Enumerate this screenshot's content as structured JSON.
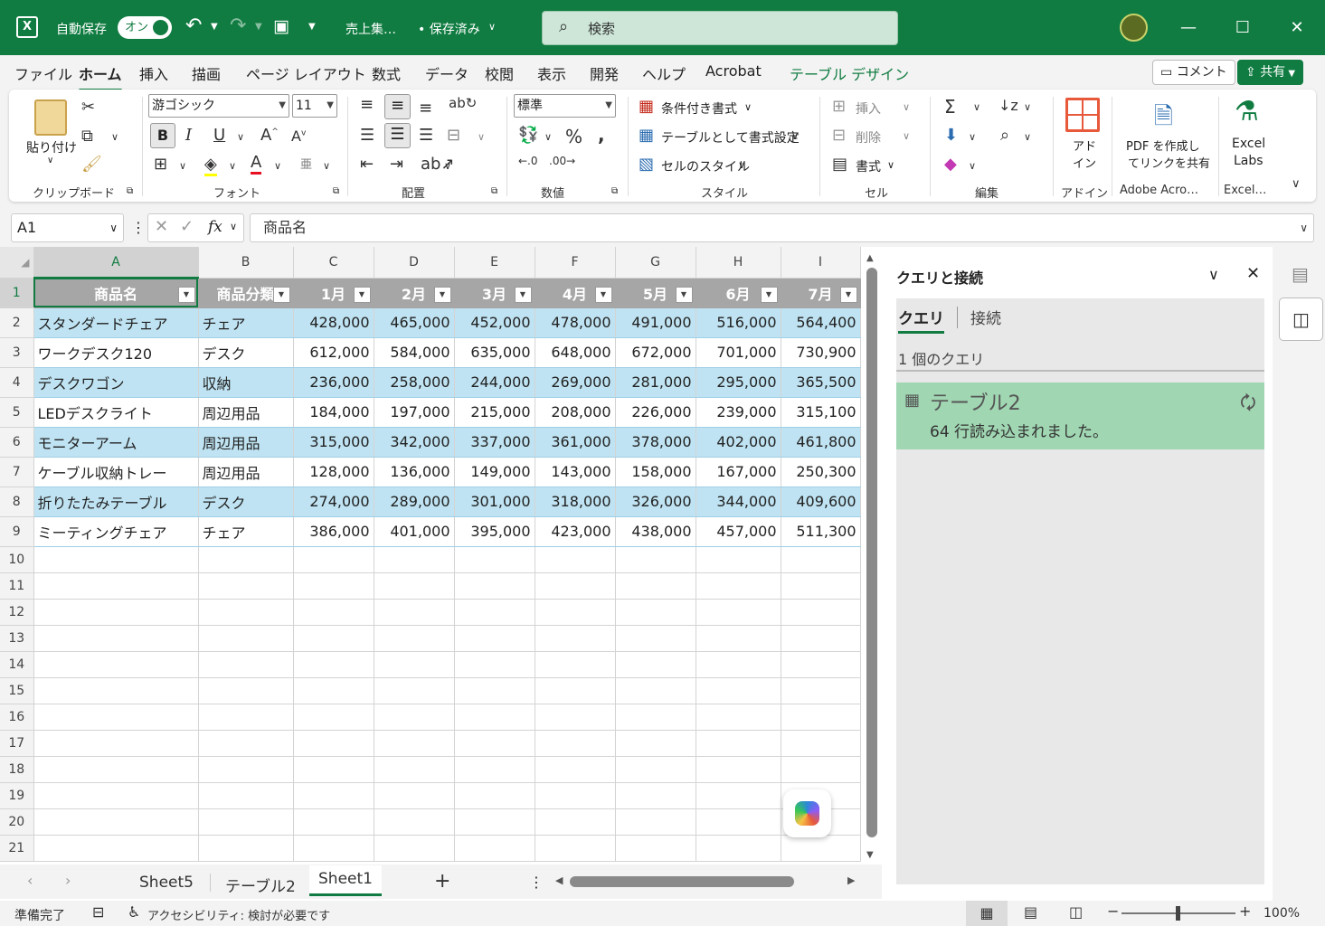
{
  "titlebar": {
    "autosave_label": "自動保存",
    "autosave_state": "オン",
    "filename": "売上集…",
    "save_status": "• 保存済み",
    "search_placeholder": "検索"
  },
  "tabs": [
    "ファイル",
    "ホーム",
    "挿入",
    "描画",
    "ページ レイアウト",
    "数式",
    "データ",
    "校閲",
    "表示",
    "開発",
    "ヘルプ",
    "Acrobat",
    "テーブル デザイン"
  ],
  "actions": {
    "comment": "コメント",
    "share": "共有"
  },
  "ribbon": {
    "clipboard": {
      "paste": "貼り付け",
      "label": "クリップボード"
    },
    "font": {
      "name": "游ゴシック",
      "size": "11",
      "label": "フォント"
    },
    "alignment": {
      "label": "配置"
    },
    "number": {
      "format": "標準",
      "label": "数値"
    },
    "styles": {
      "conditional": "条件付き書式",
      "as_table": "テーブルとして書式設定",
      "cell_styles": "セルのスタイル",
      "label": "スタイル"
    },
    "cells": {
      "insert": "挿入",
      "delete": "削除",
      "format": "書式",
      "label": "セル"
    },
    "editing": {
      "label": "編集"
    },
    "addins": {
      "line1": "アド",
      "line2": "イン",
      "label": "アドイン"
    },
    "adobe": {
      "line1": "PDF を作成し",
      "line2": "てリンクを共有",
      "label": "Adobe Acro…"
    },
    "labs": {
      "line1": "Excel",
      "line2": "Labs",
      "label": "Excel…"
    }
  },
  "formula_bar": {
    "name_box": "A1",
    "fx": "fx",
    "content": "商品名"
  },
  "columns": [
    "A",
    "B",
    "C",
    "D",
    "E",
    "F",
    "G",
    "H",
    "I"
  ],
  "table": {
    "headers": [
      "商品名",
      "商品分類",
      "1月",
      "2月",
      "3月",
      "4月",
      "5月",
      "6月",
      "7月"
    ],
    "rows": [
      [
        "スタンダードチェア",
        "チェア",
        "428,000",
        "465,000",
        "452,000",
        "478,000",
        "491,000",
        "516,000",
        "564,400"
      ],
      [
        "ワークデスク120",
        "デスク",
        "612,000",
        "584,000",
        "635,000",
        "648,000",
        "672,000",
        "701,000",
        "730,900"
      ],
      [
        "デスクワゴン",
        "収納",
        "236,000",
        "258,000",
        "244,000",
        "269,000",
        "281,000",
        "295,000",
        "365,500"
      ],
      [
        "LEDデスクライト",
        "周辺用品",
        "184,000",
        "197,000",
        "215,000",
        "208,000",
        "226,000",
        "239,000",
        "315,100"
      ],
      [
        "モニターアーム",
        "周辺用品",
        "315,000",
        "342,000",
        "337,000",
        "361,000",
        "378,000",
        "402,000",
        "461,800"
      ],
      [
        "ケーブル収納トレー",
        "周辺用品",
        "128,000",
        "136,000",
        "149,000",
        "143,000",
        "158,000",
        "167,000",
        "250,300"
      ],
      [
        "折りたたみテーブル",
        "デスク",
        "274,000",
        "289,000",
        "301,000",
        "318,000",
        "326,000",
        "344,000",
        "409,600"
      ],
      [
        "ミーティングチェア",
        "チェア",
        "386,000",
        "401,000",
        "395,000",
        "423,000",
        "438,000",
        "457,000",
        "511,300"
      ]
    ]
  },
  "row_numbers": [
    "1",
    "2",
    "3",
    "4",
    "5",
    "6",
    "7",
    "8",
    "9",
    "10",
    "11",
    "12",
    "13",
    "14",
    "15",
    "16",
    "17",
    "18",
    "19",
    "20",
    "21"
  ],
  "sheets": [
    "Sheet5",
    "テーブル2",
    "Sheet1"
  ],
  "active_sheet": "Sheet1",
  "status": {
    "ready": "準備完了",
    "accessibility": "アクセシビリティ: 検討が必要です",
    "zoom": "100%"
  },
  "pane": {
    "title": "クエリと接続",
    "tab_queries": "クエリ",
    "tab_connections": "接続",
    "count": "1 個のクエリ",
    "query_name": "テーブル2",
    "query_status": "64 行読み込まれました。"
  },
  "colors": {
    "brand": "#107c41",
    "header_fill": "#a6a6a6",
    "band_fill": "#bfe3f2",
    "query_fill": "#a0d6b2"
  }
}
